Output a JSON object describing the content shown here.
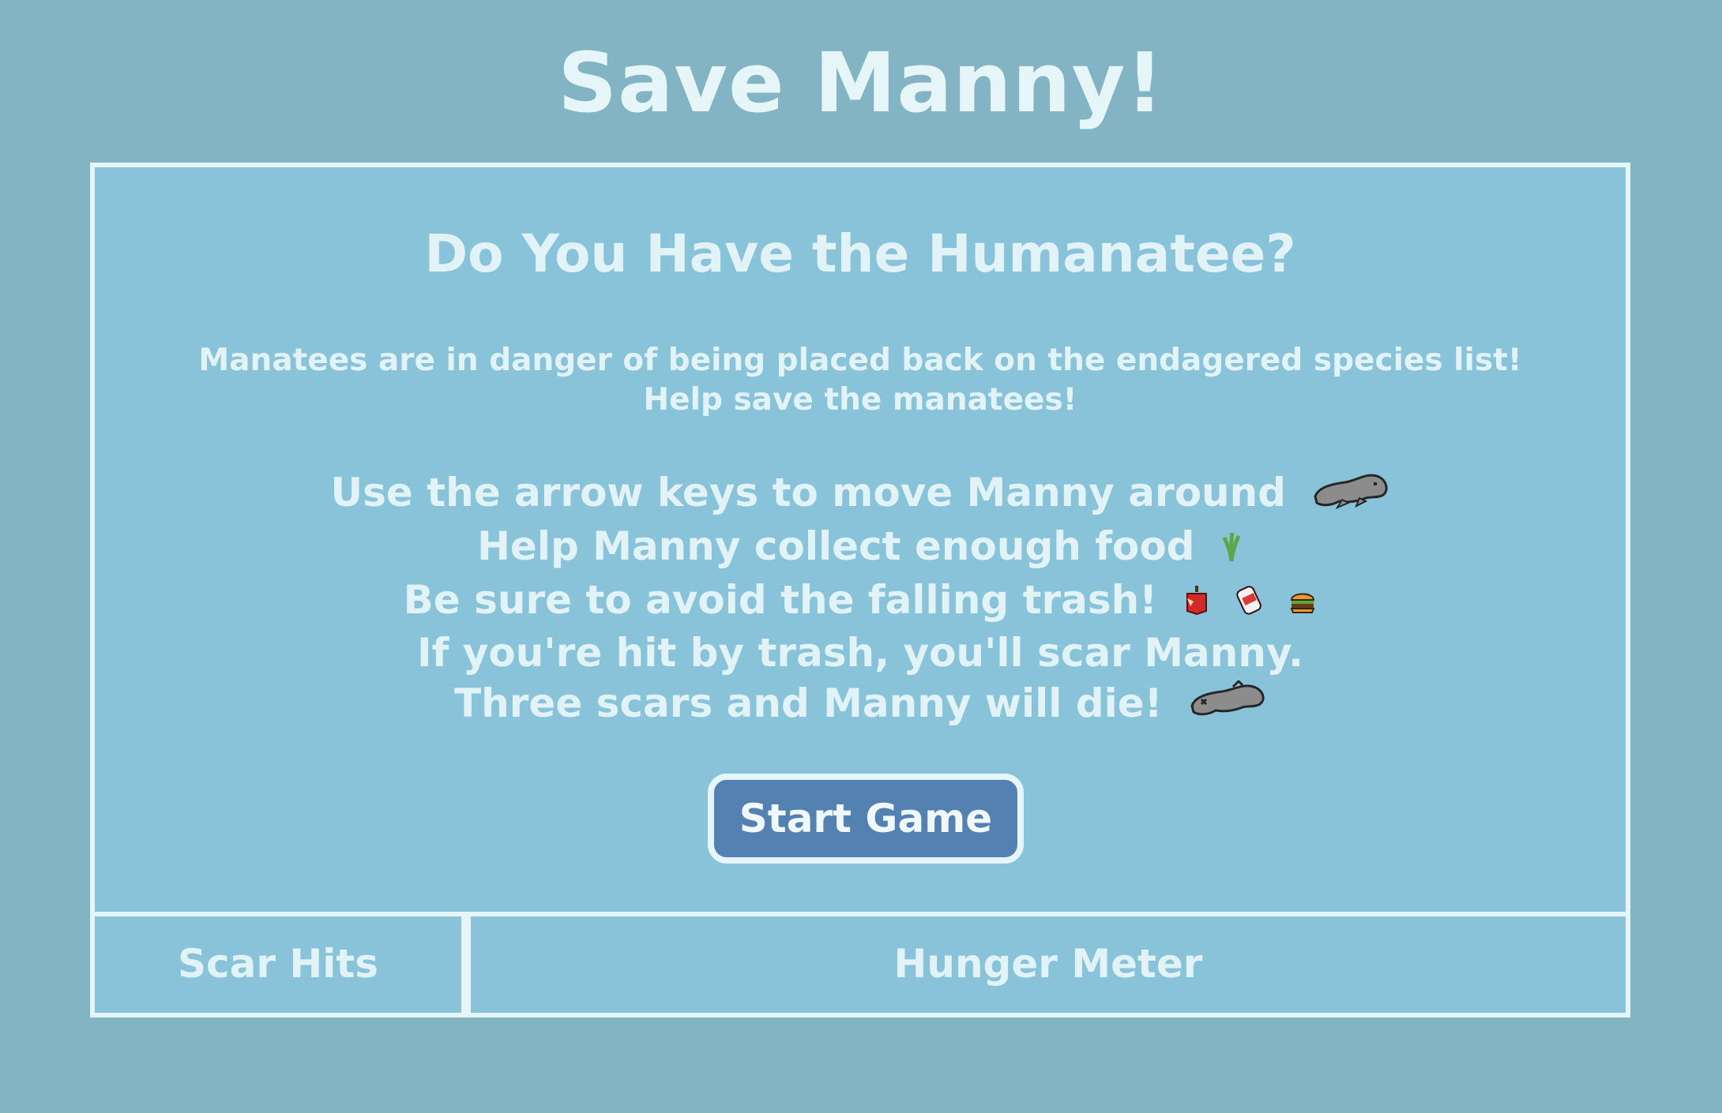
{
  "header": {
    "title": "Save Manny!"
  },
  "intro": {
    "heading": "Do You Have the Humanatee?",
    "blurb_line_1": "Manatees are in danger of being placed back on the endagered species list!",
    "blurb_line_2": "Help save the manatees!",
    "instructions": [
      {
        "text": "Use the arrow keys to move Manny around",
        "icons": [
          "manatee-icon"
        ]
      },
      {
        "text": "Help Manny collect enough food",
        "icons": [
          "seagrass-icon"
        ]
      },
      {
        "text": "Be sure to avoid the falling trash!",
        "icons": [
          "apple-core-icon",
          "soda-can-icon",
          "burger-icon"
        ]
      },
      {
        "text": "If you're hit by trash, you'll scar Manny.",
        "icons": []
      },
      {
        "text": "Three scars and Manny will die!",
        "icons": [
          "dead-manatee-icon"
        ]
      }
    ],
    "start_button_label": "Start Game"
  },
  "status": {
    "scar_hits_label": "Scar Hits",
    "hunger_meter_label": "Hunger Meter"
  },
  "colors": {
    "background": "#83b4c3",
    "panel": "#88c3d9",
    "border": "#e6f5f8",
    "button": "#5381b2",
    "text": "#e2f3f7"
  }
}
